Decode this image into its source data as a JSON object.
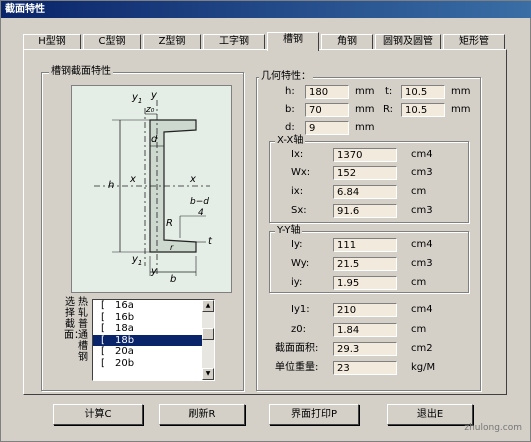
{
  "window": {
    "title": "截面特性"
  },
  "tabs": [
    {
      "label": "H型钢"
    },
    {
      "label": "C型钢"
    },
    {
      "label": "Z型钢"
    },
    {
      "label": "工字钢"
    },
    {
      "label": "槽钢"
    },
    {
      "label": "角钢"
    },
    {
      "label": "圆钢及圆管"
    },
    {
      "label": "矩形管"
    }
  ],
  "active_tab": "槽钢",
  "diagram_group": {
    "label": "槽钢截面特性"
  },
  "diagram": {
    "labels": {
      "y1_top": "y",
      "y1_top_sub": "1",
      "y_top": "y",
      "z0": "z₀",
      "d": "d",
      "h": "h",
      "x_left": "x",
      "x_right": "x",
      "r": "R",
      "r_small": "r",
      "bd_num": "b−d",
      "bd_den": "4",
      "t": "t",
      "y1_bot": "y",
      "y1_bot_sub": "1",
      "y_bot": "y",
      "b": "b"
    }
  },
  "geometry": {
    "label": "几何特性：",
    "h": {
      "label": "h:",
      "value": "180",
      "unit": "mm"
    },
    "t": {
      "label": "t:",
      "value": "10.5",
      "unit": "mm"
    },
    "b": {
      "label": "b:",
      "value": "70",
      "unit": "mm"
    },
    "R": {
      "label": "R:",
      "value": "10.5",
      "unit": "mm"
    },
    "d": {
      "label": "d:",
      "value": "9",
      "unit": "mm"
    }
  },
  "xx_axis": {
    "label": "X-X轴",
    "Ix": {
      "label": "Ix:",
      "value": "1370",
      "unit": "cm4"
    },
    "Wx": {
      "label": "Wx:",
      "value": "152",
      "unit": "cm3"
    },
    "ix": {
      "label": "ix:",
      "value": "6.84",
      "unit": "cm"
    },
    "Sx": {
      "label": "Sx:",
      "value": "91.6",
      "unit": "cm3"
    }
  },
  "yy_axis": {
    "label": "Y-Y轴",
    "Iy": {
      "label": "Iy:",
      "value": "111",
      "unit": "cm4"
    },
    "Wy": {
      "label": "Wy:",
      "value": "21.5",
      "unit": "cm3"
    },
    "iy": {
      "label": "iy:",
      "value": "1.95",
      "unit": "cm"
    }
  },
  "other": {
    "Iy1": {
      "label": "Iy1:",
      "value": "210",
      "unit": "cm4"
    },
    "z0": {
      "label": "z0:",
      "value": "1.84",
      "unit": "cm"
    },
    "area": {
      "label": "截面面积:",
      "value": "29.3",
      "unit": "cm2"
    },
    "weight": {
      "label": "单位重量:",
      "value": "23",
      "unit": "kg/M"
    }
  },
  "selector": {
    "label_cols": [
      "选择截面：",
      "热轧普通槽钢"
    ],
    "items": [
      "16a",
      "16b",
      "18a",
      "18b",
      "20a",
      "20b"
    ],
    "selected": "18b"
  },
  "buttons": {
    "calc": "计算C",
    "refresh": "刷新R",
    "print": "界面打印P",
    "exit": "退出E"
  },
  "watermark": "zhulong.com"
}
